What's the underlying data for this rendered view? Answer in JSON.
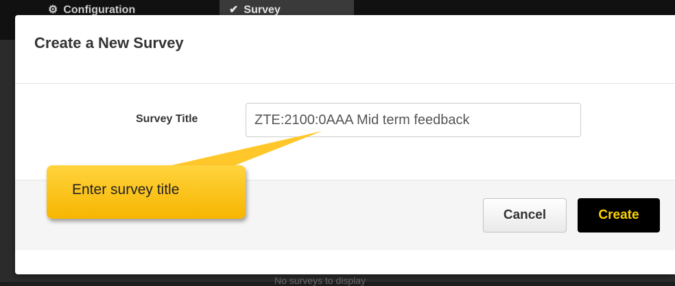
{
  "background": {
    "tabs": [
      {
        "label": "Configuration",
        "icon": "gear-icon"
      },
      {
        "label": "Survey",
        "icon": "check-icon"
      }
    ],
    "footer_text": "No surveys to display"
  },
  "dialog": {
    "title": "Create a New Survey",
    "field": {
      "label": "Survey Title",
      "value": "ZTE:2100:0AAA Mid term feedback"
    },
    "buttons": {
      "cancel": "Cancel",
      "create": "Create"
    }
  },
  "callout": {
    "text": "Enter survey title",
    "color": "#ffc000"
  },
  "colors": {
    "create_button_bg": "#000000",
    "create_button_text": "#ffd500"
  }
}
